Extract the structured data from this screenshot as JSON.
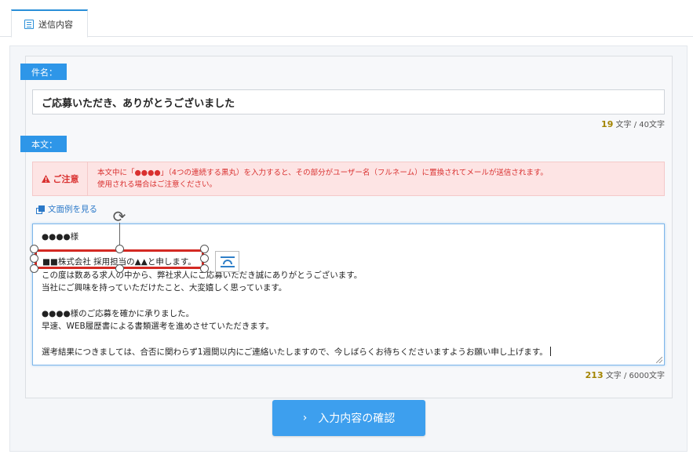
{
  "tab": {
    "label": "送信内容",
    "icon": "document-icon"
  },
  "subject": {
    "label": "件名：",
    "value": "ご応募いただき、ありがとうございました",
    "count": "19",
    "count_suffix": "文字 / 40文字"
  },
  "body": {
    "label": "本文：",
    "notice_title": "ご注意",
    "notice_icon": "warning-icon",
    "notice_line1": "本文中に「●●●●」（4つの連続する黒丸）を入力すると、その部分がユーザー名（フルネーム）に置換されてメールが送信されます。",
    "notice_line2": "使用される場合はご注意ください。",
    "example_link": "文面例を見る",
    "lines": [
      "●●●●様",
      "",
      "この度は数ある求人の中から、弊社求人にご応募いただき誠にありがとうございます。",
      "当社にご興味を持っていただけたこと、大変嬉しく思っています。",
      "",
      "●●●●様のご応募を確かに承りました。",
      "早速、WEB履歴書による書類選考を進めさせていただきます。",
      "",
      "選考結果につきましては、合否に関わらず1週間以内にご連絡いたしますので、今しばらくお待ちくださいますようお願い申し上げます。"
    ],
    "count": "213",
    "count_suffix": "文字 / 6000文字"
  },
  "floating_textbox": {
    "text": "■■株式会社 採用担当の▲▲と申します。"
  },
  "confirm_button": {
    "label": "入力内容の確認"
  },
  "colors": {
    "accent": "#2e96e8",
    "warning": "#d9302f",
    "selection": "#d42a23",
    "counter_highlight": "#a38400"
  }
}
